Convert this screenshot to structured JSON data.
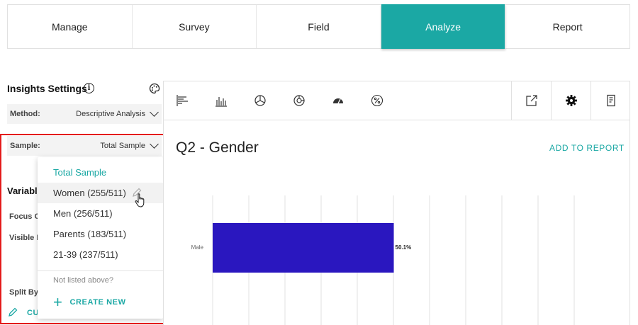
{
  "topnav": {
    "tabs": [
      {
        "label": "Manage",
        "active": false
      },
      {
        "label": "Survey",
        "active": false
      },
      {
        "label": "Field",
        "active": false
      },
      {
        "label": "Analyze",
        "active": true
      },
      {
        "label": "Report",
        "active": false
      }
    ]
  },
  "settings": {
    "title": "Insights Settings",
    "info_icon": "i",
    "method_label": "Method:",
    "method_value": "Descriptive Analysis",
    "sample_label": "Sample:",
    "sample_value": "Total Sample",
    "variables_label": "Variable",
    "focus_label": "Focus O",
    "visible_label": "Visible I",
    "split_label": "Split By",
    "customize_label": "CU"
  },
  "sample_dropdown": {
    "options": [
      {
        "label": "Total Sample",
        "selected": true
      },
      {
        "label": "Women (255/511)",
        "hover": true
      },
      {
        "label": "Men (256/511)"
      },
      {
        "label": "Parents (183/511)"
      },
      {
        "label": "21-39 (237/511)"
      }
    ],
    "note": "Not listed above?",
    "create_label": "CREATE NEW"
  },
  "chart": {
    "title": "Q2 - Gender",
    "add_to_report": "ADD TO REPORT"
  },
  "colors": {
    "accent": "#1ba8a4",
    "bar": "#2a17bf",
    "highlight": "#e31b1b"
  },
  "chart_data": {
    "type": "bar",
    "orientation": "horizontal",
    "categories": [
      "Male"
    ],
    "values": [
      50.1
    ],
    "value_labels": [
      "50.1%"
    ],
    "xlim": [
      0,
      100
    ],
    "grid": true
  }
}
